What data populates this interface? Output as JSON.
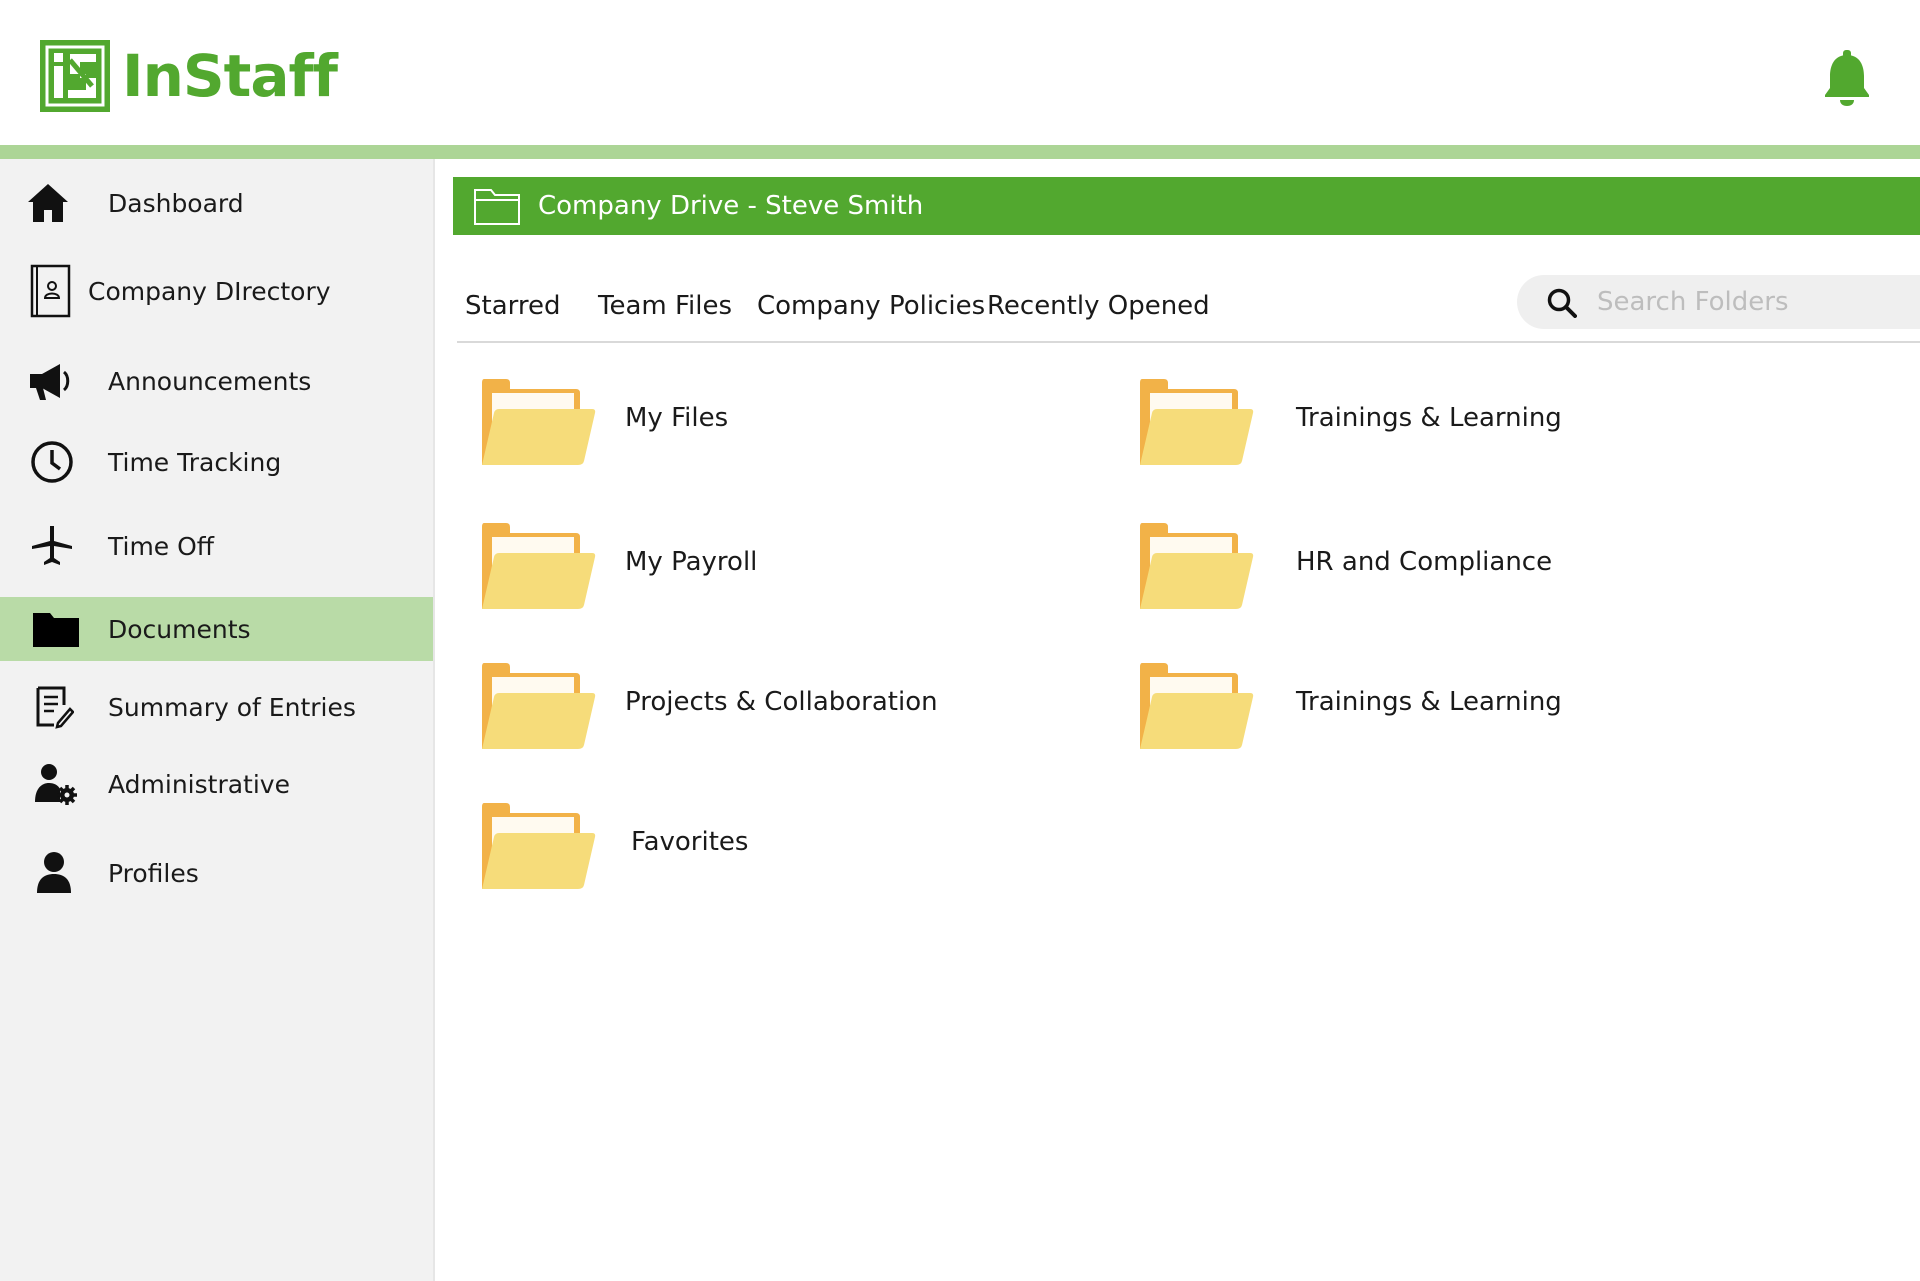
{
  "header": {
    "logo_text": "InStaff",
    "logo_icon": "instaff-logo-icon",
    "notification_icon": "bell-icon",
    "brand_color": "#52a82f"
  },
  "sidebar": {
    "items": [
      {
        "label": "Dashboard",
        "icon": "home-icon"
      },
      {
        "label": "Company DIrectory",
        "icon": "address-book-icon"
      },
      {
        "label": "Announcements",
        "icon": "megaphone-icon"
      },
      {
        "label": "Time Tracking",
        "icon": "clock-icon"
      },
      {
        "label": "Time Off",
        "icon": "airplane-icon"
      },
      {
        "label": "Documents",
        "icon": "folder-icon",
        "active": true
      },
      {
        "label": "Summary of Entries",
        "icon": "document-edit-icon"
      },
      {
        "label": "Administrative",
        "icon": "user-gear-icon"
      },
      {
        "label": "Profiles",
        "icon": "user-icon"
      }
    ],
    "active_color": "#b9dba7"
  },
  "main": {
    "drive_title": "Company Drive - Steve Smith",
    "tabs": [
      {
        "label": "Starred"
      },
      {
        "label": "Team Files"
      },
      {
        "label": "Company Policies"
      },
      {
        "label": "Recently Opened"
      }
    ],
    "search": {
      "placeholder": "Search Folders",
      "icon": "search-icon"
    },
    "folders": [
      {
        "label": "My Files"
      },
      {
        "label": "Trainings & Learning"
      },
      {
        "label": "My Payroll"
      },
      {
        "label": "HR and Compliance"
      },
      {
        "label": "Projects & Collaboration"
      },
      {
        "label": "Trainings & Learning"
      },
      {
        "label": "Favorites"
      }
    ],
    "folder_color": "#f6dc7a"
  }
}
